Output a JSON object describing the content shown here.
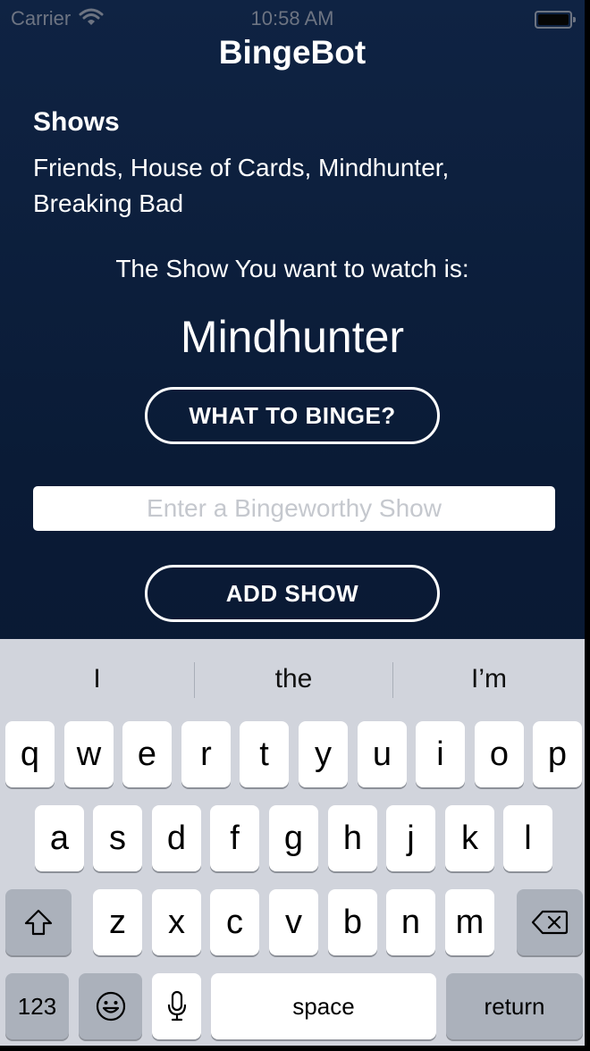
{
  "status_bar": {
    "carrier": "Carrier",
    "time": "10:58 AM"
  },
  "app": {
    "title": "BingeBot",
    "shows_heading": "Shows",
    "shows_list": "Friends, House of Cards, Mindhunter, Breaking Bad",
    "prompt": "The Show You want to watch is:",
    "result": "Mindhunter",
    "binge_button": "WHAT TO BINGE?",
    "input_value": "",
    "input_placeholder": "Enter a Bingeworthy Show",
    "add_button": "ADD SHOW"
  },
  "keyboard": {
    "suggestions": [
      "I",
      "the",
      "I’m"
    ],
    "row1": [
      "q",
      "w",
      "e",
      "r",
      "t",
      "y",
      "u",
      "i",
      "o",
      "p"
    ],
    "row2": [
      "a",
      "s",
      "d",
      "f",
      "g",
      "h",
      "j",
      "k",
      "l"
    ],
    "row3": [
      "z",
      "x",
      "c",
      "v",
      "b",
      "n",
      "m"
    ],
    "numbers_key": "123",
    "space_key": "space",
    "return_key": "return",
    "icons": {
      "shift": "shift-icon",
      "delete": "delete-icon",
      "emoji": "emoji-icon",
      "mic": "microphone-icon"
    }
  }
}
